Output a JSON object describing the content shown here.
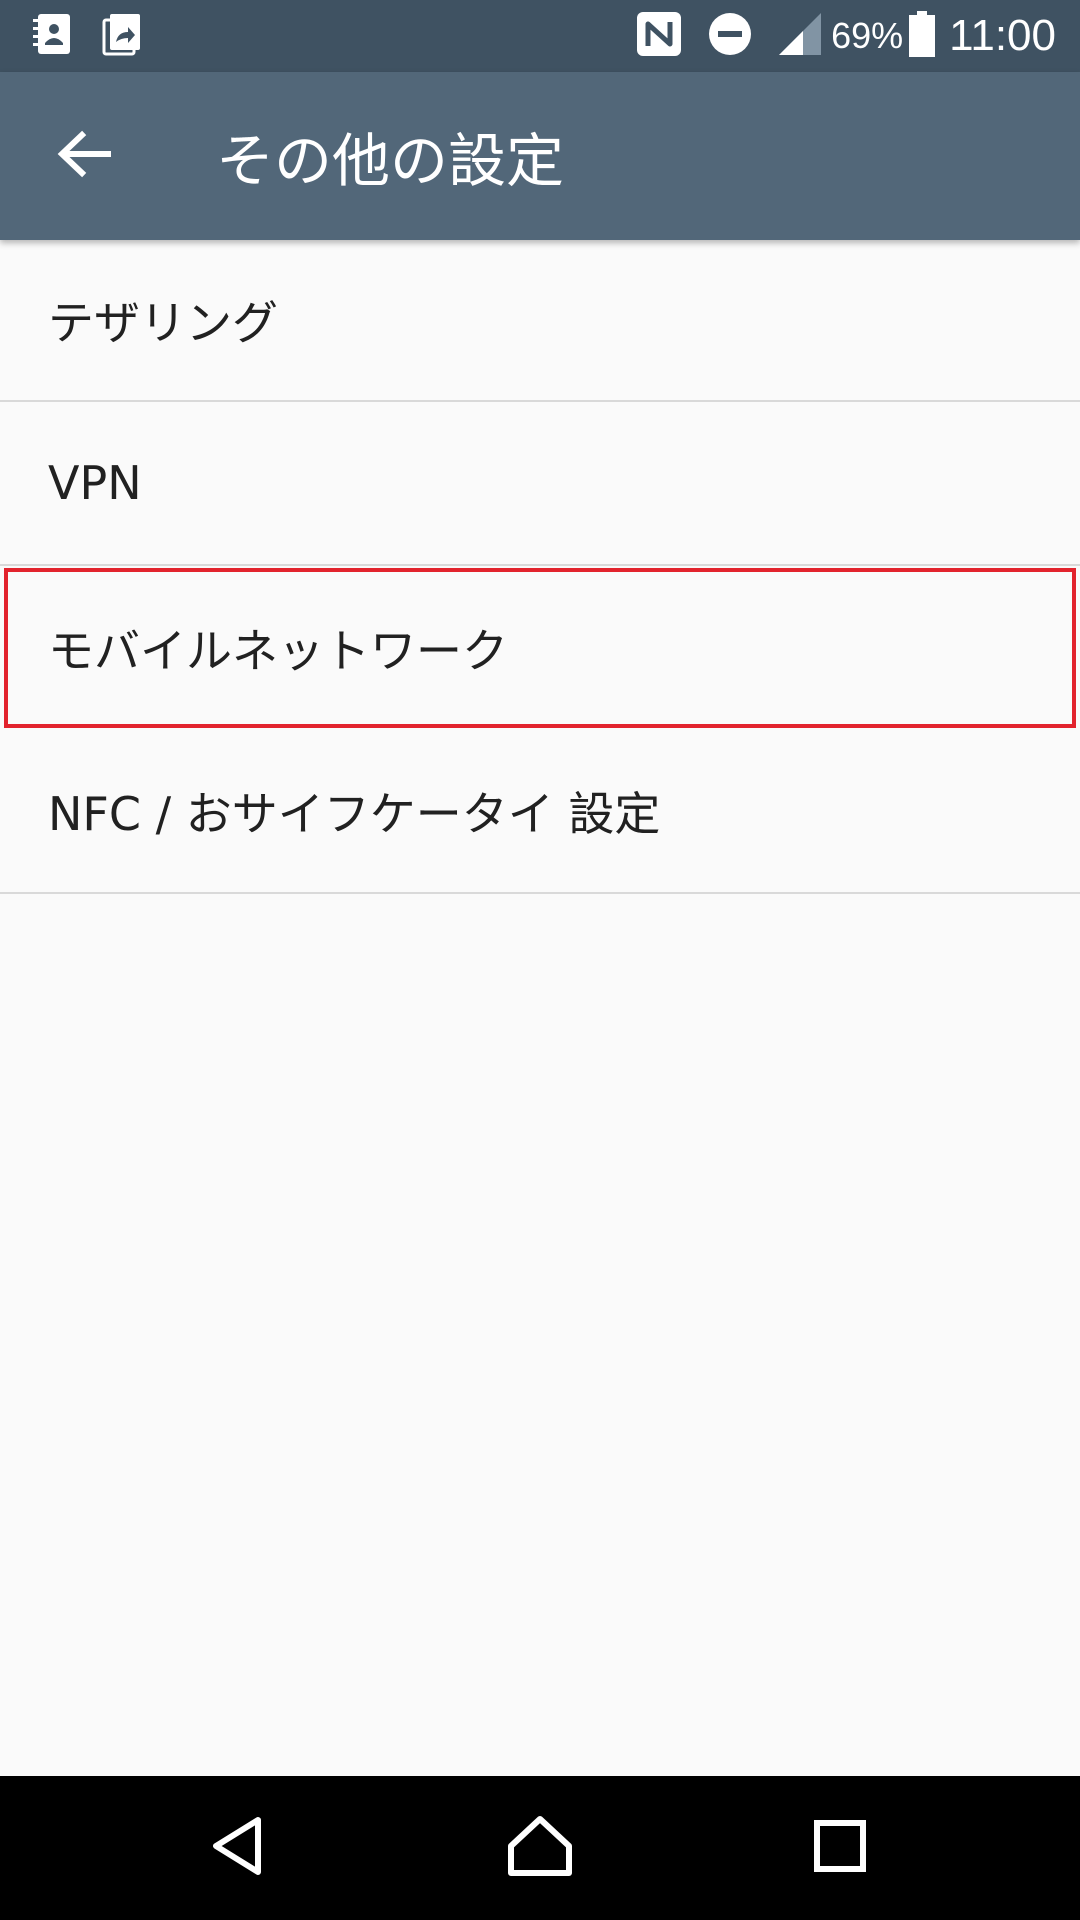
{
  "status_bar": {
    "left_icons": [
      "contacts-icon",
      "screen-share-icon"
    ],
    "right_icons": [
      "nfc-icon",
      "do-not-disturb-icon",
      "signal-icon"
    ],
    "battery_percent": "69%",
    "time": "11:00"
  },
  "app_bar": {
    "title": "その他の設定",
    "back_icon": "arrow-back-icon"
  },
  "list": {
    "items": [
      {
        "label": "テザリング"
      },
      {
        "label": "VPN"
      },
      {
        "label": "モバイルネットワーク",
        "highlighted": true
      },
      {
        "label": "NFC / おサイフケータイ 設定"
      }
    ]
  },
  "nav_bar": {
    "buttons": [
      "back-triangle-icon",
      "home-icon",
      "recents-icon"
    ]
  },
  "colors": {
    "status_bar": "#3f5262",
    "app_bar": "#526779",
    "background": "#fafafa",
    "highlight": "#e2232d",
    "nav_bar": "#000000"
  }
}
